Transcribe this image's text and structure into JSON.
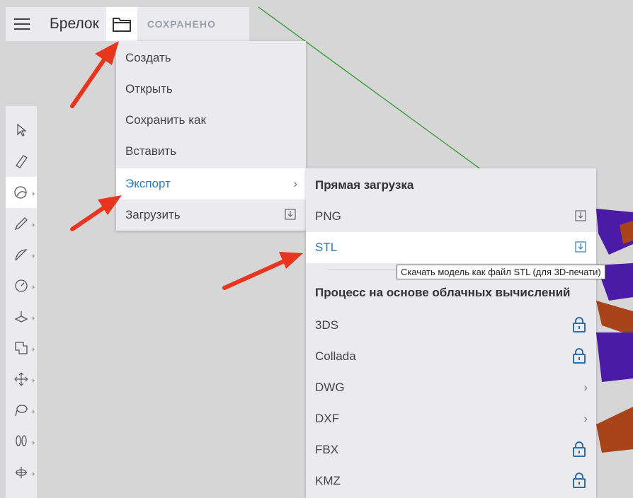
{
  "header": {
    "menu_icon": "hamburger-icon",
    "title": "Брелок",
    "folder_icon": "folder-icon",
    "status": "СОХРАНЕНО"
  },
  "file_menu": {
    "items": [
      {
        "label": "Создать"
      },
      {
        "label": "Открыть"
      },
      {
        "label": "Сохранить как"
      },
      {
        "label": "Вставить"
      },
      {
        "label": "Экспорт"
      },
      {
        "label": "Загрузить"
      }
    ]
  },
  "export_menu": {
    "direct_heading": "Прямая загрузка",
    "direct_items": [
      {
        "label": "PNG",
        "icon": "download-icon"
      },
      {
        "label": "STL",
        "icon": "download-icon"
      }
    ],
    "cloud_heading": "Процесс на основе облачных вычислений",
    "cloud_items": [
      {
        "label": "3DS",
        "icon": "lock-icon"
      },
      {
        "label": "Collada",
        "icon": "lock-icon"
      },
      {
        "label": "DWG",
        "icon": "chevron-right-icon"
      },
      {
        "label": "DXF",
        "icon": "chevron-right-icon"
      },
      {
        "label": "FBX",
        "icon": "lock-icon"
      },
      {
        "label": "KMZ",
        "icon": "lock-icon"
      }
    ]
  },
  "tooltip": "Скачать модель как файл STL (для 3D-печати)",
  "toolbar": {
    "tools": [
      "select-icon",
      "eraser-icon",
      "paint-icon",
      "pencil-icon",
      "arc-icon",
      "tape-measure-icon",
      "push-pull-icon",
      "offset-icon",
      "move-icon",
      "orbit-icon",
      "walk-icon",
      "section-icon"
    ]
  },
  "colors": {
    "accent": "#2a7bbd",
    "arrow": "#e8361e",
    "model_purple": "#4b1aa6",
    "model_brown": "#a8431a",
    "axis_green": "#2e9a2e"
  }
}
